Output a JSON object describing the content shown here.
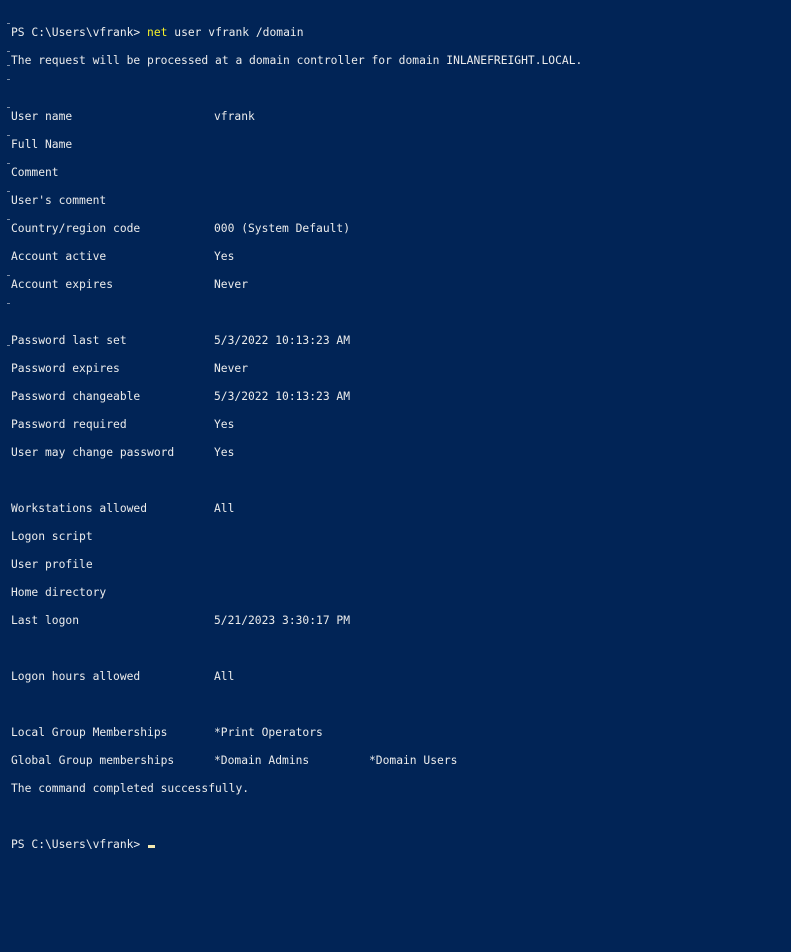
{
  "prompt": "PS C:\\Users\\vfrank>",
  "command": {
    "name": "net",
    "args": "user vfrank /domain"
  },
  "request_message": "The request will be processed at a domain controller for domain INLANEFREIGHT.LOCAL.",
  "fields": {
    "user_name": {
      "label": "User name",
      "value": "vfrank"
    },
    "full_name": {
      "label": "Full Name",
      "value": ""
    },
    "comment": {
      "label": "Comment",
      "value": ""
    },
    "users_comment": {
      "label": "User's comment",
      "value": ""
    },
    "country_code": {
      "label": "Country/region code",
      "value": "000 (System Default)"
    },
    "account_active": {
      "label": "Account active",
      "value": "Yes"
    },
    "account_expires": {
      "label": "Account expires",
      "value": "Never"
    },
    "password_last_set": {
      "label": "Password last set",
      "value": "5/3/2022 10:13:23 AM"
    },
    "password_expires": {
      "label": "Password expires",
      "value": "Never"
    },
    "password_changeable": {
      "label": "Password changeable",
      "value": "5/3/2022 10:13:23 AM"
    },
    "password_required": {
      "label": "Password required",
      "value": "Yes"
    },
    "user_may_change_password": {
      "label": "User may change password",
      "value": "Yes"
    },
    "workstations_allowed": {
      "label": "Workstations allowed",
      "value": "All"
    },
    "logon_script": {
      "label": "Logon script",
      "value": ""
    },
    "user_profile": {
      "label": "User profile",
      "value": ""
    },
    "home_directory": {
      "label": "Home directory",
      "value": ""
    },
    "last_logon": {
      "label": "Last logon",
      "value": "5/21/2023 3:30:17 PM"
    },
    "logon_hours_allowed": {
      "label": "Logon hours allowed",
      "value": "All"
    },
    "local_groups": {
      "label": "Local Group Memberships",
      "values": [
        "*Print Operators"
      ]
    },
    "global_groups": {
      "label": "Global Group memberships",
      "values": [
        "*Domain Admins",
        "*Domain Users"
      ]
    }
  },
  "completion_message": "The command completed successfully.",
  "colors": {
    "background": "#012456",
    "text": "#ececec",
    "command_highlight": "#f6f02a"
  }
}
